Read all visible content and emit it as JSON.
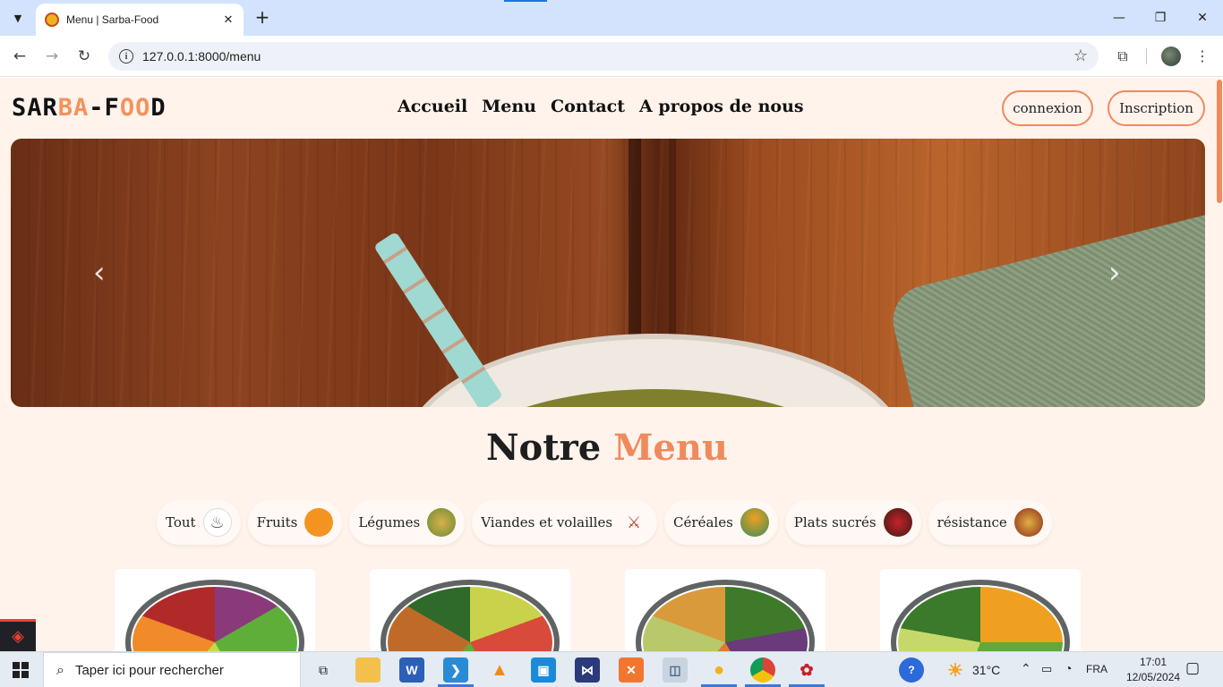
{
  "browser": {
    "tab_title": "Menu | Sarba-Food",
    "tab_close": "✕",
    "new_tab": "+",
    "url": "127.0.0.1:8000/menu",
    "window_controls": {
      "minimize": "—",
      "maximize": "❐",
      "close": "✕"
    }
  },
  "site": {
    "logo": {
      "part1": "SAR",
      "part2": "BA",
      "part3": "-F",
      "part4": "OO",
      "part5": "D"
    },
    "nav": [
      "Accueil",
      "Menu",
      "Contact",
      "A propos de nous"
    ],
    "auth": {
      "login": "connexion",
      "signup": "Inscription"
    },
    "carousel": {
      "prev": "‹",
      "next": "›"
    },
    "section_title": {
      "part1": "Notre",
      "part2": "Menu"
    },
    "filters": [
      {
        "label": "Tout",
        "icon": "chef-hat-icon",
        "glyph": "♨"
      },
      {
        "label": "Fruits",
        "icon": "oranges-icon",
        "glyph": "●"
      },
      {
        "label": "Légumes",
        "icon": "vegetables-icon",
        "glyph": "●"
      },
      {
        "label": "Viandes et volailles",
        "icon": "skewers-icon",
        "glyph": "⚔"
      },
      {
        "label": "Céréales",
        "icon": "cereal-bowl-icon",
        "glyph": "●"
      },
      {
        "label": "Plats sucrés",
        "icon": "chocolate-fruit-icon",
        "glyph": "●"
      },
      {
        "label": "résistance",
        "icon": "stew-icon",
        "glyph": "●"
      }
    ],
    "colors": {
      "accent": "#f08a5c",
      "background": "#fff3ec",
      "text": "#111111"
    }
  },
  "taskbar": {
    "search_placeholder": "Taper ici pour rechercher",
    "weather": "31°C",
    "language": "FRA",
    "time": "17:01",
    "date": "12/05/2024"
  }
}
